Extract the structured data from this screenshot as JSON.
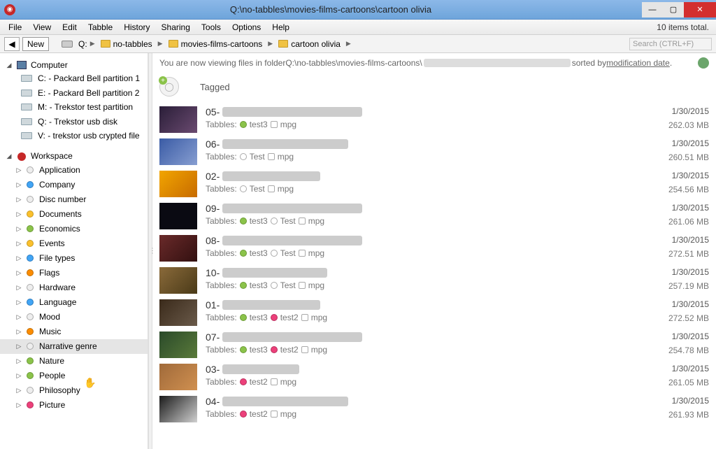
{
  "title": "Q:\\no-tabbles\\movies-films-cartoons\\cartoon olivia",
  "menu": [
    "File",
    "View",
    "Edit",
    "Tabble",
    "History",
    "Sharing",
    "Tools",
    "Options",
    "Help"
  ],
  "items_total": "10 items total.",
  "toolbar": {
    "new_label": "New",
    "drive": "Q:"
  },
  "breadcrumbs": [
    "no-tabbles",
    "movies-films-cartoons",
    "cartoon olivia"
  ],
  "search_placeholder": "Search (CTRL+F)",
  "info_prefix": "You are now viewing files in folder ",
  "info_path": "Q:\\no-tabbles\\movies-films-cartoons\\",
  "info_sorted_by": " sorted by ",
  "sort_link": "modification date",
  "header_col": "Tagged",
  "computer_label": "Computer",
  "drives": [
    "C: - Packard Bell partition 1",
    "E: - Packard Bell partition 2",
    "M: - Trekstor test partition",
    "Q: - Trekstor usb disk",
    "V: - trekstor usb crypted file"
  ],
  "workspace_label": "Workspace",
  "categories": [
    {
      "label": "Application",
      "color": "grey"
    },
    {
      "label": "Company",
      "color": "blue"
    },
    {
      "label": "Disc number",
      "color": "grey"
    },
    {
      "label": "Documents",
      "color": "yellow"
    },
    {
      "label": "Economics",
      "color": "green"
    },
    {
      "label": "Events",
      "color": "yellow"
    },
    {
      "label": "File types",
      "color": "blue"
    },
    {
      "label": "Flags",
      "color": "orange"
    },
    {
      "label": "Hardware",
      "color": "grey"
    },
    {
      "label": "Language",
      "color": "blue"
    },
    {
      "label": "Mood",
      "color": "grey"
    },
    {
      "label": "Music",
      "color": "orange"
    },
    {
      "label": "Narrative genre",
      "color": "grey",
      "selected": true
    },
    {
      "label": "Nature",
      "color": "green"
    },
    {
      "label": "People",
      "color": "green"
    },
    {
      "label": "Philosophy",
      "color": "grey"
    },
    {
      "label": "Picture",
      "color": "pink"
    }
  ],
  "tags": {
    "tabbles_prefix": "Tabbles:",
    "test3": "test3",
    "test": "Test",
    "test2": "test2",
    "mpg": "mpg"
  },
  "files": [
    {
      "prefix": "05-",
      "date": "1/30/2015",
      "size": "262.03 MB",
      "tags": [
        "test3_g",
        "mpg_sq"
      ],
      "thumb": "t0",
      "blur": 200
    },
    {
      "prefix": "06-",
      "date": "1/30/2015",
      "size": "260.51 MB",
      "tags": [
        "test_r",
        "mpg_sq"
      ],
      "thumb": "t1",
      "blur": 180
    },
    {
      "prefix": "02-",
      "date": "1/30/2015",
      "size": "254.56 MB",
      "tags": [
        "test_r",
        "mpg_sq"
      ],
      "thumb": "t2",
      "blur": 140
    },
    {
      "prefix": "09-",
      "date": "1/30/2015",
      "size": "261.06 MB",
      "tags": [
        "test3_g",
        "test_r",
        "mpg_sq"
      ],
      "thumb": "t3",
      "blur": 200
    },
    {
      "prefix": "08-",
      "date": "1/30/2015",
      "size": "272.51 MB",
      "tags": [
        "test3_g",
        "test_r",
        "mpg_sq"
      ],
      "thumb": "t4",
      "blur": 200
    },
    {
      "prefix": "10-",
      "date": "1/30/2015",
      "size": "257.19 MB",
      "tags": [
        "test3_g",
        "test_r",
        "mpg_sq"
      ],
      "thumb": "t5",
      "blur": 150
    },
    {
      "prefix": "01-",
      "date": "1/30/2015",
      "size": "272.52 MB",
      "tags": [
        "test3_g",
        "test2_p",
        "mpg_sq"
      ],
      "thumb": "t6",
      "blur": 140
    },
    {
      "prefix": "07-",
      "date": "1/30/2015",
      "size": "254.78 MB",
      "tags": [
        "test3_g",
        "test2_p",
        "mpg_sq"
      ],
      "thumb": "t7",
      "blur": 200
    },
    {
      "prefix": "03-",
      "date": "1/30/2015",
      "size": "261.05 MB",
      "tags": [
        "test2_p",
        "mpg_sq"
      ],
      "thumb": "t8",
      "blur": 110
    },
    {
      "prefix": "04-",
      "date": "1/30/2015",
      "size": "261.93 MB",
      "tags": [
        "test2_p",
        "mpg_sq"
      ],
      "thumb": "t9",
      "blur": 180
    }
  ]
}
